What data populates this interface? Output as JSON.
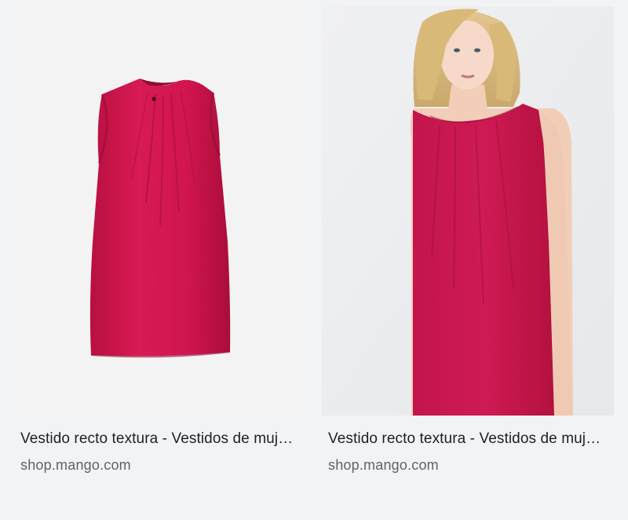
{
  "results": [
    {
      "image_alt": "Red sleeveless shift dress product photo",
      "title": "Vestido recto textura - Vestidos de mujer | Mango",
      "source": "shop.mango.com"
    },
    {
      "image_alt": "Model wearing red sleeveless shift dress",
      "title": "Vestido recto textura - Vestidos de mujer | Mango",
      "source": "shop.mango.com"
    }
  ],
  "colors": {
    "dress": "#d0154f",
    "dress_shadow": "#a30f3d",
    "background": "#f1f3f4",
    "title_text": "#202124",
    "source_text": "#5f6368"
  }
}
